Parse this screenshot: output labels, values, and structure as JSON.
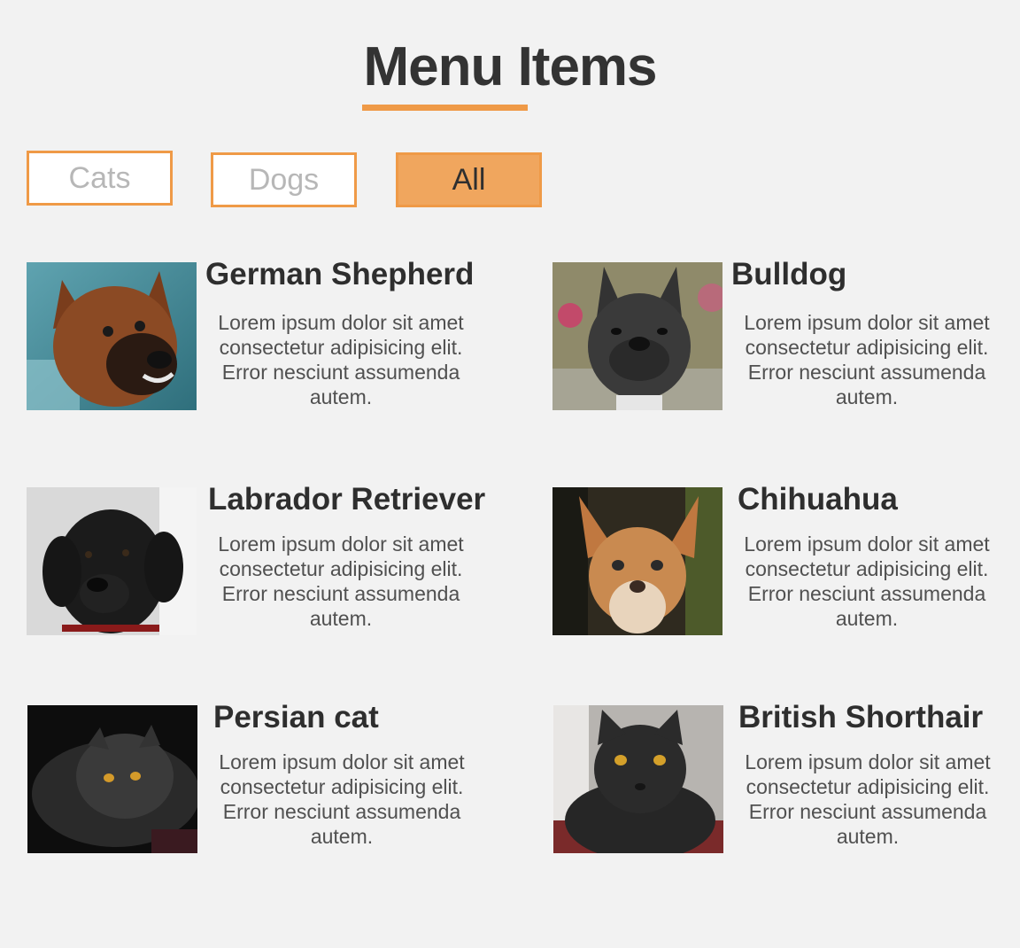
{
  "page": {
    "title": "Menu Items",
    "accent_color": "#ef9a47"
  },
  "filters": [
    {
      "label": "Cats",
      "active": false
    },
    {
      "label": "Dogs",
      "active": false
    },
    {
      "label": "All",
      "active": true
    }
  ],
  "items": [
    {
      "name": "German Shepherd",
      "description": "Lorem ipsum dolor sit amet consectetur adipisicing elit. Error nesciunt assumenda autem.",
      "image": "german-shepherd-photo"
    },
    {
      "name": "Bulldog",
      "description": "Lorem ipsum dolor sit amet consectetur adipisicing elit. Error nesciunt assumenda autem.",
      "image": "bulldog-photo"
    },
    {
      "name": "Labrador Retriever",
      "description": "Lorem ipsum dolor sit amet consectetur adipisicing elit. Error nesciunt assumenda autem.",
      "image": "labrador-photo"
    },
    {
      "name": "Chihuahua",
      "description": "Lorem ipsum dolor sit amet consectetur adipisicing elit. Error nesciunt assumenda autem.",
      "image": "chihuahua-photo"
    },
    {
      "name": "Persian cat",
      "description": "Lorem ipsum dolor sit amet consectetur adipisicing elit. Error nesciunt assumenda autem.",
      "image": "persian-cat-photo"
    },
    {
      "name": "British Shorthair",
      "description": "Lorem ipsum dolor sit amet consectetur adipisicing elit. Error nesciunt assumenda autem.",
      "image": "british-shorthair-photo"
    }
  ]
}
